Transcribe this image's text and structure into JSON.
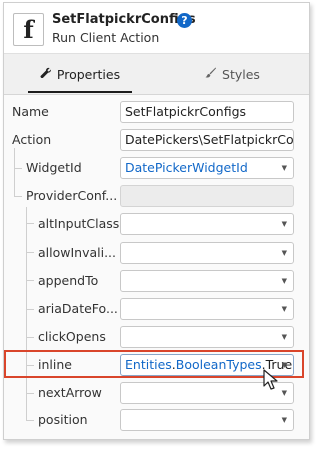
{
  "header": {
    "icon_glyph": "f",
    "title": "SetFlatpickrConfigs",
    "help_glyph": "?",
    "subtitle": "Run Client Action"
  },
  "tabs": [
    {
      "label": "Properties",
      "icon": "wrench-icon",
      "active": true
    },
    {
      "label": "Styles",
      "icon": "brush-icon",
      "active": false
    }
  ],
  "properties": {
    "name": {
      "label": "Name",
      "value": "SetFlatpickrConfigs"
    },
    "action": {
      "label": "Action",
      "value": "DatePickers\\SetFlatpickrCo"
    },
    "widget_id": {
      "label": "WidgetId",
      "value": "DatePickerWidgetId"
    },
    "provider_conf": {
      "label": "ProviderConf...",
      "value": ""
    },
    "alt_input_class": {
      "label": "altInputClass",
      "value": ""
    },
    "allow_invalid": {
      "label": "allowInvali...",
      "value": ""
    },
    "append_to": {
      "label": "appendTo",
      "value": ""
    },
    "aria_date": {
      "label": "ariaDateFo...",
      "value": ""
    },
    "click_opens": {
      "label": "clickOpens",
      "value": ""
    },
    "inline": {
      "label": "inline",
      "value_part1": "Entities",
      "value_dot1": ".",
      "value_part2": "BooleanTypes",
      "value_dot2": ".",
      "value_part3": "True"
    },
    "next_arrow": {
      "label": "nextArrow",
      "value": ""
    },
    "position": {
      "label": "position",
      "value": ""
    }
  },
  "caret_glyph": "▼",
  "colors": {
    "accent": "#1268c8",
    "highlight": "#d9452b"
  }
}
